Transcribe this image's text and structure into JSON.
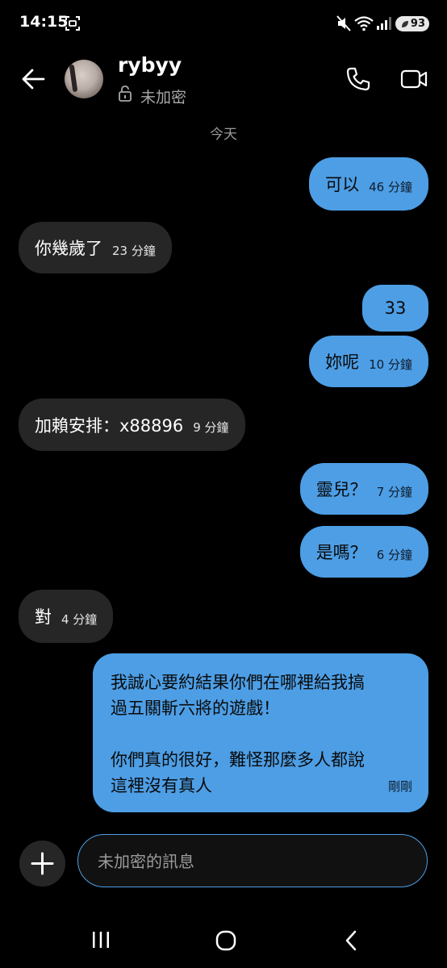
{
  "status_bar": {
    "time": "14:15",
    "battery": "93"
  },
  "header": {
    "contact_name": "rybyy",
    "encryption": "未加密"
  },
  "date_separator": "今天",
  "messages": [
    {
      "side": "out",
      "text": "可以",
      "time": "46 分鐘"
    },
    {
      "side": "in",
      "text": "你幾歲了",
      "time": "23 分鐘"
    },
    {
      "side": "out",
      "text": "33",
      "time": ""
    },
    {
      "side": "out",
      "text": "妳呢",
      "time": "10 分鐘"
    },
    {
      "side": "in",
      "text": "加賴安排：x88896",
      "time": "9 分鐘"
    },
    {
      "side": "out",
      "text": "靈兒？",
      "time": "7 分鐘"
    },
    {
      "side": "out",
      "text": "是嗎？",
      "time": "6 分鐘"
    },
    {
      "side": "in",
      "text": "對",
      "time": "4 分鐘"
    },
    {
      "side": "out",
      "lines": [
        "我誠心要約結果你們在哪裡給我搞",
        "過五關斬六將的遊戲！",
        "",
        "你們真的很好，難怪那麼多人都說",
        "這裡沒有真人"
      ],
      "time": "剛剛"
    }
  ],
  "composer": {
    "placeholder": "未加密的訊息"
  },
  "colors": {
    "background": "#000000",
    "outgoing_bubble": "#4d9ee5",
    "incoming_bubble": "#262626",
    "accent": "#4d9ee5"
  },
  "icons": [
    "back-arrow-icon",
    "lock-icon",
    "phone-icon",
    "video-call-icon",
    "plus-icon",
    "recents-icon",
    "home-icon",
    "nav-back-icon"
  ]
}
